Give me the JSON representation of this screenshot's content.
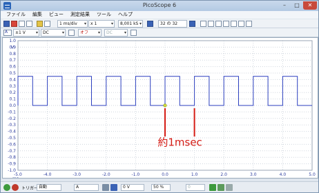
{
  "window": {
    "title": "PicoScope 6"
  },
  "menu": [
    "ファイル",
    "編集",
    "ビュー",
    "測定結果",
    "ツール",
    "ヘルプ"
  ],
  "toolbar1": {
    "timebase": "1 ms/div",
    "zoom": "x 1",
    "samples": "8,001 kS",
    "buffer": "32 の 32"
  },
  "toolbar2": {
    "channel_label": "A",
    "range": "±1 V",
    "coupling": "DC",
    "off1": "オフ",
    "off2": "DC"
  },
  "status": {
    "trigger_label": "トリガー",
    "trigger_mode": "自動",
    "trigger_channel": "A",
    "threshold": "0 V",
    "pretrigger": "50 %",
    "delay": "0"
  },
  "annotation": {
    "text": "約1msec"
  },
  "chart_data": {
    "type": "line",
    "xlabel": "ms",
    "ylabel": "V",
    "x_range": [
      -5.0,
      5.0
    ],
    "y_range": [
      -1.0,
      1.0
    ],
    "x_ticks": [
      "-5.0",
      "-4.0",
      "-3.0",
      "-2.0",
      "-1.0",
      "0.0",
      "1.0",
      "2.0",
      "3.0",
      "4.0",
      "5.0"
    ],
    "y_ticks": [
      "1.0",
      "0.9",
      "0.8",
      "0.7",
      "0.6",
      "0.5",
      "0.4",
      "0.3",
      "0.2",
      "0.1",
      "0.0",
      "-0.1",
      "-0.2",
      "-0.3",
      "-0.4",
      "-0.5",
      "-0.6",
      "-0.7",
      "-0.8",
      "-0.9",
      "-1.0"
    ],
    "grid": true,
    "series": [
      {
        "color": "#2b3fbf",
        "period_ms": 1.0,
        "high_v": 0.45,
        "low_v": 0.0,
        "duty": 0.5,
        "rising_edge_ms": -5.0
      }
    ],
    "markers": [
      0.0,
      1.0
    ]
  }
}
